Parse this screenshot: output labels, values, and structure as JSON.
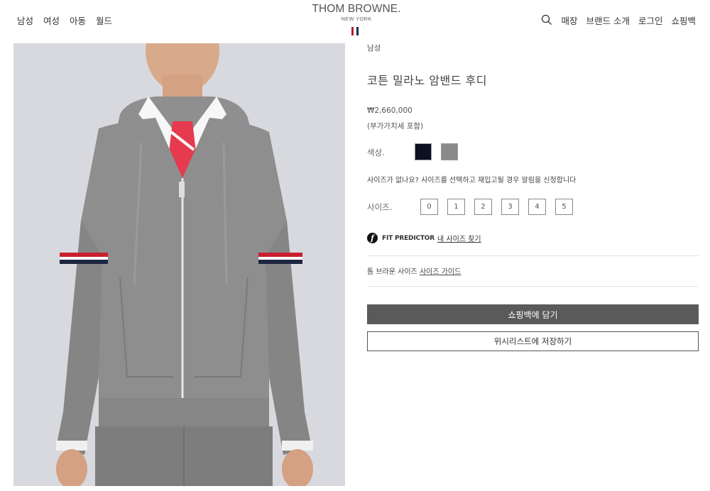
{
  "header": {
    "nav_left": [
      "남성",
      "여성",
      "아동",
      "월드"
    ],
    "logo_main": "THOM BROWNE.",
    "logo_sub": "NEW YORK",
    "nav_right": [
      "매장",
      "브랜드 소개",
      "로그인",
      "쇼핑백"
    ],
    "flag_colors": [
      "#b81d2c",
      "#ffffff",
      "#1f2b55"
    ]
  },
  "product": {
    "breadcrumb": "남성",
    "title": "코튼 밀라노 암밴드 후디",
    "price": "₩2,660,000",
    "vat_note": "(부가가치세 포함)",
    "color_label": "색상.",
    "colors": [
      {
        "name": "navy",
        "hex": "#0c1020"
      },
      {
        "name": "grey",
        "hex": "#8a8a8a"
      }
    ],
    "size_note": "사이즈가 없나요? 사이즈를 선택하고 재입고될 경우 알림을 신청합니다",
    "size_label": "사이즈.",
    "sizes": [
      "0",
      "1",
      "2",
      "3",
      "4",
      "5"
    ],
    "fit_predictor_label": "FIT PREDICTOR",
    "fit_predictor_link": "내 사이즈 찾기",
    "size_guide_prefix": "톰 브라운 사이즈",
    "size_guide_link": "사이즈 가이드",
    "add_to_bag": "쇼핑백에 담기",
    "add_to_wishlist": "위시리스트에 저장하기"
  }
}
